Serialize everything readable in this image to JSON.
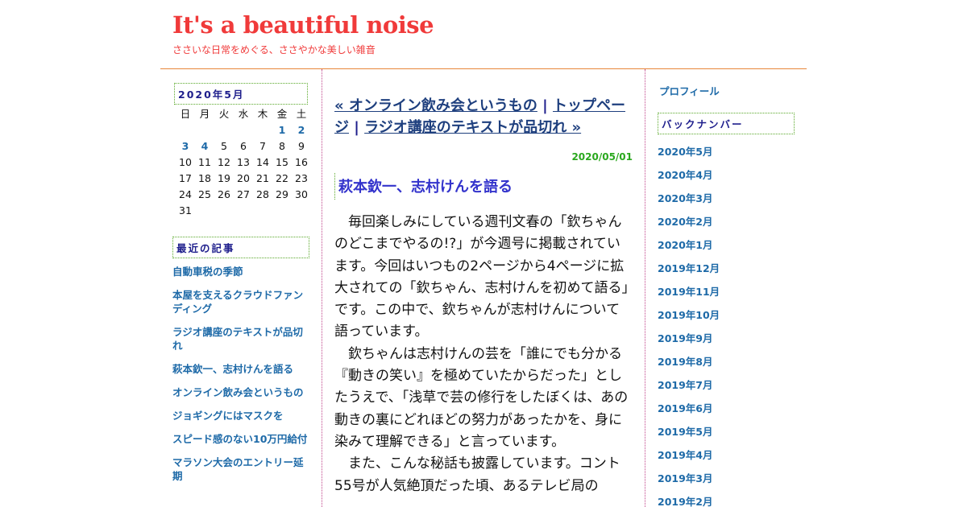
{
  "blog": {
    "title": "It's a beautiful noise",
    "description": "ささいな日常をめぐる、ささやかな美しい雑音"
  },
  "calendar": {
    "heading": "2020年5月",
    "weekdays": [
      "日",
      "月",
      "火",
      "水",
      "木",
      "金",
      "土"
    ],
    "days": [
      "",
      "",
      "",
      "",
      "",
      "1",
      "2",
      "3",
      "4",
      "5",
      "6",
      "7",
      "8",
      "9",
      "10",
      "11",
      "12",
      "13",
      "14",
      "15",
      "16",
      "17",
      "18",
      "19",
      "20",
      "21",
      "22",
      "23",
      "24",
      "25",
      "26",
      "27",
      "28",
      "29",
      "30",
      "31"
    ],
    "linked_days": [
      "1",
      "2",
      "3",
      "4"
    ]
  },
  "recent": {
    "heading": "最近の記事",
    "items": [
      "自動車税の季節",
      "本屋を支えるクラウドファンディング",
      "ラジオ講座のテキストが品切れ",
      "萩本欽一、志村けんを語る",
      "オンライン飲み会というもの",
      "ジョギングにはマスクを",
      "スピード感のない10万円給付",
      "マラソン大会のエントリー延期"
    ]
  },
  "nav": {
    "prev": "« オンライン飲み会というもの",
    "sep1": " | ",
    "top": "トップページ",
    "sep2": " | ",
    "next": "ラジオ講座のテキストが品切れ »"
  },
  "post": {
    "date": "2020/05/01",
    "title": "萩本欽一、志村けんを語る",
    "paragraphs": [
      "毎回楽しみにしている週刊文春の「欽ちゃんのどこまでやるの!?」が今週号に掲載されています。今回はいつもの2ページから4ページに拡大されての「欽ちゃん、志村けんを初めて語る」です。この中で、欽ちゃんが志村けんについて語っています。",
      "欽ちゃんは志村けんの芸を「誰にでも分かる『動きの笑い』を極めていたからだった」としたうえで、「浅草で芸の修行をしたぼくは、あの動きの裏にどれほどの努力があったかを、身に染みて理解できる」と言っています。",
      "また、こんな秘話も披露しています。コント55号が人気絶頂だった頃、あるテレビ局の"
    ]
  },
  "sidebar_right": {
    "profile": "プロフィール",
    "backnumber_heading": "バックナンバー",
    "archives": [
      "2020年5月",
      "2020年4月",
      "2020年3月",
      "2020年2月",
      "2020年1月",
      "2019年12月",
      "2019年11月",
      "2019年10月",
      "2019年9月",
      "2019年8月",
      "2019年7月",
      "2019年6月",
      "2019年5月",
      "2019年4月",
      "2019年3月",
      "2019年2月"
    ]
  },
  "colors": {
    "title_red": "#f03a3a",
    "link_blue": "#1e6aa8",
    "date_green": "#2aa81e",
    "entry_title_blue": "#3333cc",
    "rule_orange": "#e8863a",
    "separator_magenta": "#c0448a"
  }
}
